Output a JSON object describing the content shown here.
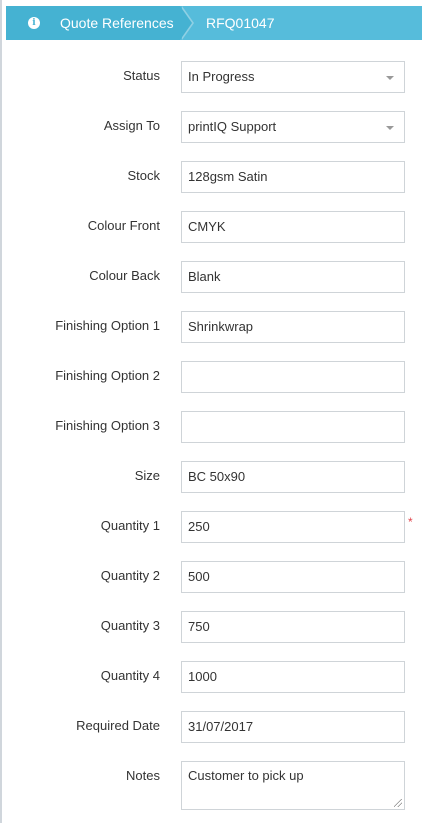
{
  "breadcrumb": {
    "section": "Quote References",
    "reference": "RFQ01047"
  },
  "fields": [
    {
      "label": "Status",
      "value": "In Progress",
      "type": "select"
    },
    {
      "label": "Assign To",
      "value": "printIQ Support",
      "type": "select"
    },
    {
      "label": "Stock",
      "value": "128gsm Satin",
      "type": "text"
    },
    {
      "label": "Colour Front",
      "value": "CMYK",
      "type": "text"
    },
    {
      "label": "Colour Back",
      "value": "Blank",
      "type": "text"
    },
    {
      "label": "Finishing Option 1",
      "value": "Shrinkwrap",
      "type": "text"
    },
    {
      "label": "Finishing Option 2",
      "value": "",
      "type": "text"
    },
    {
      "label": "Finishing Option 3",
      "value": "",
      "type": "text"
    },
    {
      "label": "Size",
      "value": "BC 50x90",
      "type": "text"
    },
    {
      "label": "Quantity 1",
      "value": "250",
      "type": "text",
      "required_mark": "*"
    },
    {
      "label": "Quantity 2",
      "value": "500",
      "type": "text"
    },
    {
      "label": "Quantity 3",
      "value": "750",
      "type": "text"
    },
    {
      "label": "Quantity 4",
      "value": "1000",
      "type": "text"
    },
    {
      "label": "Required Date",
      "value": "31/07/2017",
      "type": "text"
    },
    {
      "label": "Notes",
      "value": "Customer to pick up",
      "type": "textarea"
    }
  ],
  "icons": {
    "breadcrumb_info": "info-icon"
  }
}
